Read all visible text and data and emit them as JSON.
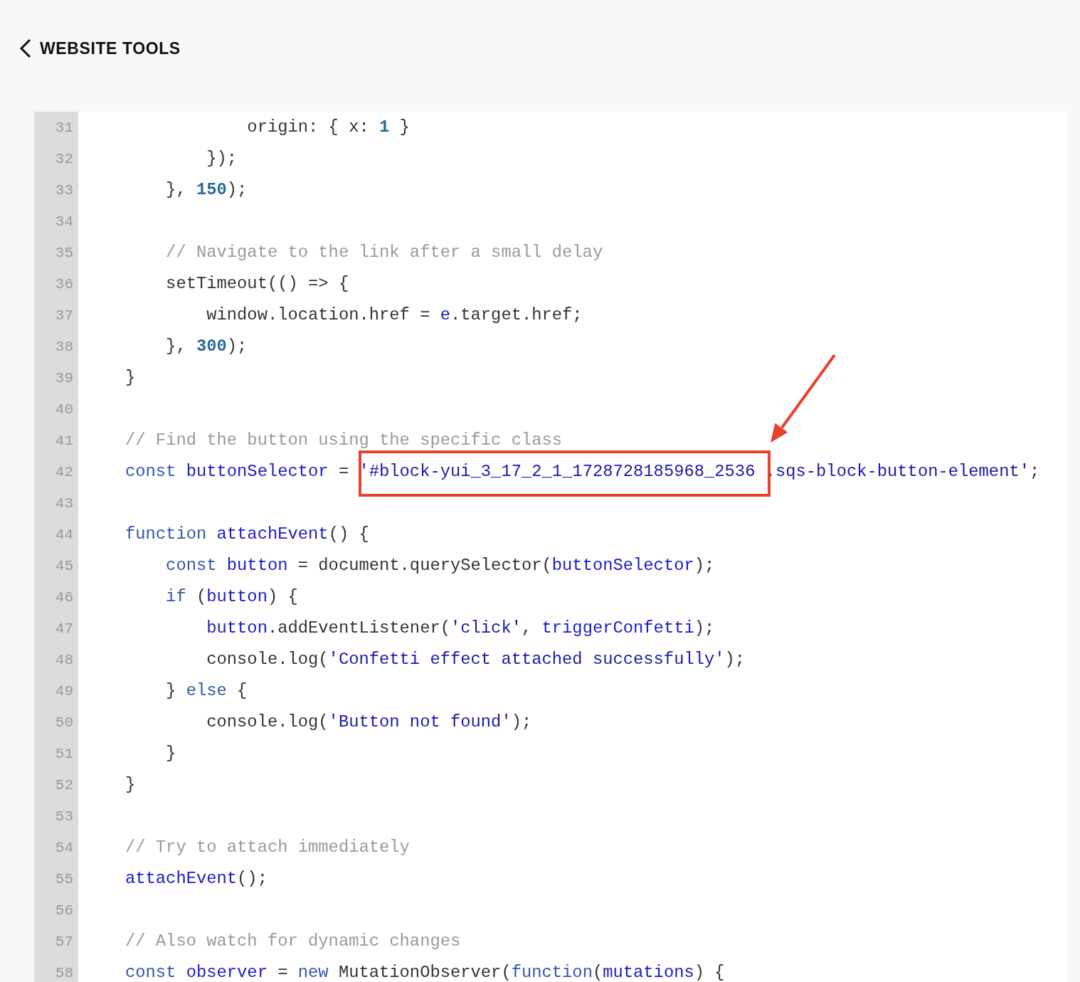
{
  "header": {
    "back_label": "WEBSITE TOOLS"
  },
  "editor": {
    "lines": [
      {
        "number": "31",
        "tokens": [
          {
            "kind": "plain",
            "text": "            origin: { x: "
          },
          {
            "kind": "number",
            "text": "1"
          },
          {
            "kind": "plain",
            "text": " }"
          }
        ]
      },
      {
        "number": "32",
        "tokens": [
          {
            "kind": "plain",
            "text": "        });"
          }
        ]
      },
      {
        "number": "33",
        "tokens": [
          {
            "kind": "plain",
            "text": "    }, "
          },
          {
            "kind": "number",
            "text": "150"
          },
          {
            "kind": "plain",
            "text": ");"
          }
        ]
      },
      {
        "number": "34"
      },
      {
        "number": "35",
        "tokens": [
          {
            "kind": "comment",
            "text": "    // Navigate to the link after a small delay"
          }
        ]
      },
      {
        "number": "36",
        "tokens": [
          {
            "kind": "plain",
            "text": "    setTimeout(() => {"
          }
        ]
      },
      {
        "number": "37",
        "tokens": [
          {
            "kind": "plain",
            "text": "        window.location.href = "
          },
          {
            "kind": "variable",
            "text": "e"
          },
          {
            "kind": "plain",
            "text": ".target.href;"
          }
        ]
      },
      {
        "number": "38",
        "tokens": [
          {
            "kind": "plain",
            "text": "    }, "
          },
          {
            "kind": "number",
            "text": "300"
          },
          {
            "kind": "plain",
            "text": ");"
          }
        ]
      },
      {
        "number": "39",
        "tokens": [
          {
            "kind": "plain",
            "text": "}"
          }
        ]
      },
      {
        "number": "40"
      },
      {
        "number": "41",
        "tokens": [
          {
            "kind": "comment",
            "text": "// Find the button using the specific class"
          }
        ]
      },
      {
        "number": "42",
        "tokens": [
          {
            "kind": "keyword",
            "text": "const"
          },
          {
            "kind": "variable",
            "text": " buttonSelector"
          },
          {
            "kind": "plain",
            "text": " = "
          },
          {
            "kind": "string",
            "text": "'#block-yui_3_17_2_1_1728728185968_2536 .sqs-block-button-element'"
          },
          {
            "kind": "plain",
            "text": ";"
          }
        ]
      },
      {
        "number": "43"
      },
      {
        "number": "44",
        "tokens": [
          {
            "kind": "keyword",
            "text": "function"
          },
          {
            "kind": "variable",
            "text": " attachEvent"
          },
          {
            "kind": "plain",
            "text": "() {"
          }
        ]
      },
      {
        "number": "45",
        "tokens": [
          {
            "kind": "keyword",
            "text": "    const"
          },
          {
            "kind": "variable",
            "text": " button"
          },
          {
            "kind": "plain",
            "text": " = document.querySelector("
          },
          {
            "kind": "variable",
            "text": "buttonSelector"
          },
          {
            "kind": "plain",
            "text": ");"
          }
        ]
      },
      {
        "number": "46",
        "tokens": [
          {
            "kind": "keyword",
            "text": "    if"
          },
          {
            "kind": "plain",
            "text": " ("
          },
          {
            "kind": "variable",
            "text": "button"
          },
          {
            "kind": "plain",
            "text": ") {"
          }
        ]
      },
      {
        "number": "47",
        "tokens": [
          {
            "kind": "variable",
            "text": "        button"
          },
          {
            "kind": "plain",
            "text": ".addEventListener("
          },
          {
            "kind": "string",
            "text": "'click'"
          },
          {
            "kind": "plain",
            "text": ", "
          },
          {
            "kind": "variable",
            "text": "triggerConfetti"
          },
          {
            "kind": "plain",
            "text": ");"
          }
        ]
      },
      {
        "number": "48",
        "tokens": [
          {
            "kind": "plain",
            "text": "        console.log("
          },
          {
            "kind": "string",
            "text": "'Confetti effect attached successfully'"
          },
          {
            "kind": "plain",
            "text": ");"
          }
        ]
      },
      {
        "number": "49",
        "tokens": [
          {
            "kind": "plain",
            "text": "    } "
          },
          {
            "kind": "keyword",
            "text": "else"
          },
          {
            "kind": "plain",
            "text": " {"
          }
        ]
      },
      {
        "number": "50",
        "tokens": [
          {
            "kind": "plain",
            "text": "        console.log("
          },
          {
            "kind": "string",
            "text": "'Button not found'"
          },
          {
            "kind": "plain",
            "text": ");"
          }
        ]
      },
      {
        "number": "51",
        "tokens": [
          {
            "kind": "plain",
            "text": "    }"
          }
        ]
      },
      {
        "number": "52",
        "tokens": [
          {
            "kind": "plain",
            "text": "}"
          }
        ]
      },
      {
        "number": "53"
      },
      {
        "number": "54",
        "tokens": [
          {
            "kind": "comment",
            "text": "// Try to attach immediately"
          }
        ]
      },
      {
        "number": "55",
        "tokens": [
          {
            "kind": "variable",
            "text": "attachEvent"
          },
          {
            "kind": "plain",
            "text": "();"
          }
        ]
      },
      {
        "number": "56"
      },
      {
        "number": "57",
        "tokens": [
          {
            "kind": "comment",
            "text": "// Also watch for dynamic changes"
          }
        ]
      },
      {
        "number": "58",
        "tokens": [
          {
            "kind": "keyword",
            "text": "const"
          },
          {
            "kind": "variable",
            "text": " observer"
          },
          {
            "kind": "plain",
            "text": " = "
          },
          {
            "kind": "keyword",
            "text": "new"
          },
          {
            "kind": "plain",
            "text": " MutationObserver("
          },
          {
            "kind": "keyword",
            "text": "function"
          },
          {
            "kind": "plain",
            "text": "("
          },
          {
            "kind": "variable",
            "text": "mutations"
          },
          {
            "kind": "plain",
            "text": ") {"
          }
        ]
      }
    ]
  }
}
